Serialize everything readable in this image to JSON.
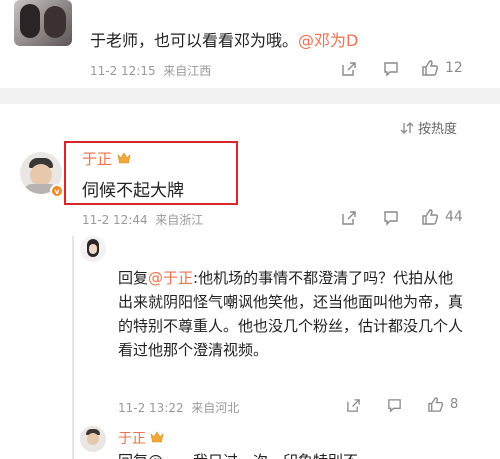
{
  "comment_top": {
    "text_prefix": "于老师，也可以看看邓为哦。",
    "mention": "@邓为D",
    "time": "11-2 12:15",
    "location": "来自江西",
    "likes": "12"
  },
  "sort": {
    "label": "按热度"
  },
  "comment_main": {
    "author": "于正",
    "text": "伺候不起大牌",
    "time": "11-2 12:44",
    "location": "来自浙江",
    "likes": "44"
  },
  "reply_1": {
    "reply_word": "回复",
    "mention": "@于正",
    "text": ":他机场的事情不都澄清了吗？代拍从他出来就阴阳怪气嘲讽他笑他，还当他面叫他为帝，真的特别不尊重人。他也没几个粉丝，估计都没几个人看过他那个澄清视频。",
    "time": "11-2 13:22",
    "location": "来自河北",
    "likes": "8"
  },
  "reply_2": {
    "author": "于正",
    "text_partial": "回复@……我只过一次，印象特别不"
  },
  "colors": {
    "highlight_box": "#d9262c",
    "mention": "#eb7350",
    "badge_orange": "#f08a24"
  }
}
